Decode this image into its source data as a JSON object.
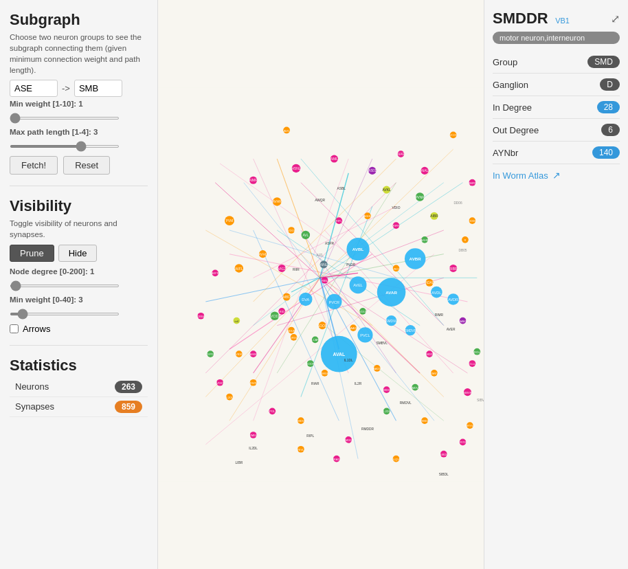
{
  "leftPanel": {
    "subgraph": {
      "title": "Subgraph",
      "description": "Choose two neuron groups to see the subgraph connecting them (given minimum connection weight and path length).",
      "fromValue": "ASE",
      "arrowLabel": "->",
      "toValue": "SMB",
      "minWeightLabel": "Min weight [1-10]:",
      "minWeightValue": "1",
      "maxPathLabel": "Max path length [1-4]:",
      "maxPathValue": "3",
      "fetchLabel": "Fetch!",
      "resetLabel": "Reset"
    },
    "visibility": {
      "title": "Visibility",
      "description": "Toggle visibility of neurons and synapses.",
      "pruneLabel": "Prune",
      "hideLabel": "Hide",
      "nodeDegreeLabel": "Node degree [0-200]:",
      "nodeDegreeValue": "1",
      "minWeightLabel": "Min weight [0-40]:",
      "minWeightValue": "3",
      "arrowsLabel": "Arrows"
    },
    "statistics": {
      "title": "Statistics",
      "neuronsLabel": "Neurons",
      "neuronsValue": "263",
      "synapsesLabel": "Synapses",
      "synapsesValue": "859"
    }
  },
  "rightPanel": {
    "title": "SMDDR",
    "vb1Label": "VB1",
    "neuronType": "motor neuron,interneuron",
    "groupLabel": "Group",
    "groupValue": "SMD",
    "ganglionLabel": "Ganglion",
    "ganglionValue": "D",
    "inDegreeLabel": "In Degree",
    "inDegreeValue": "28",
    "outDegreeLabel": "Out Degree",
    "outDegreeValue": "6",
    "ayNbrLabel": "AYNbr",
    "ayNbrValue": "140",
    "wormAtlasLabel": "In Worm Atlas"
  },
  "icons": {
    "expand": "⤢",
    "externalLink": "↗"
  }
}
